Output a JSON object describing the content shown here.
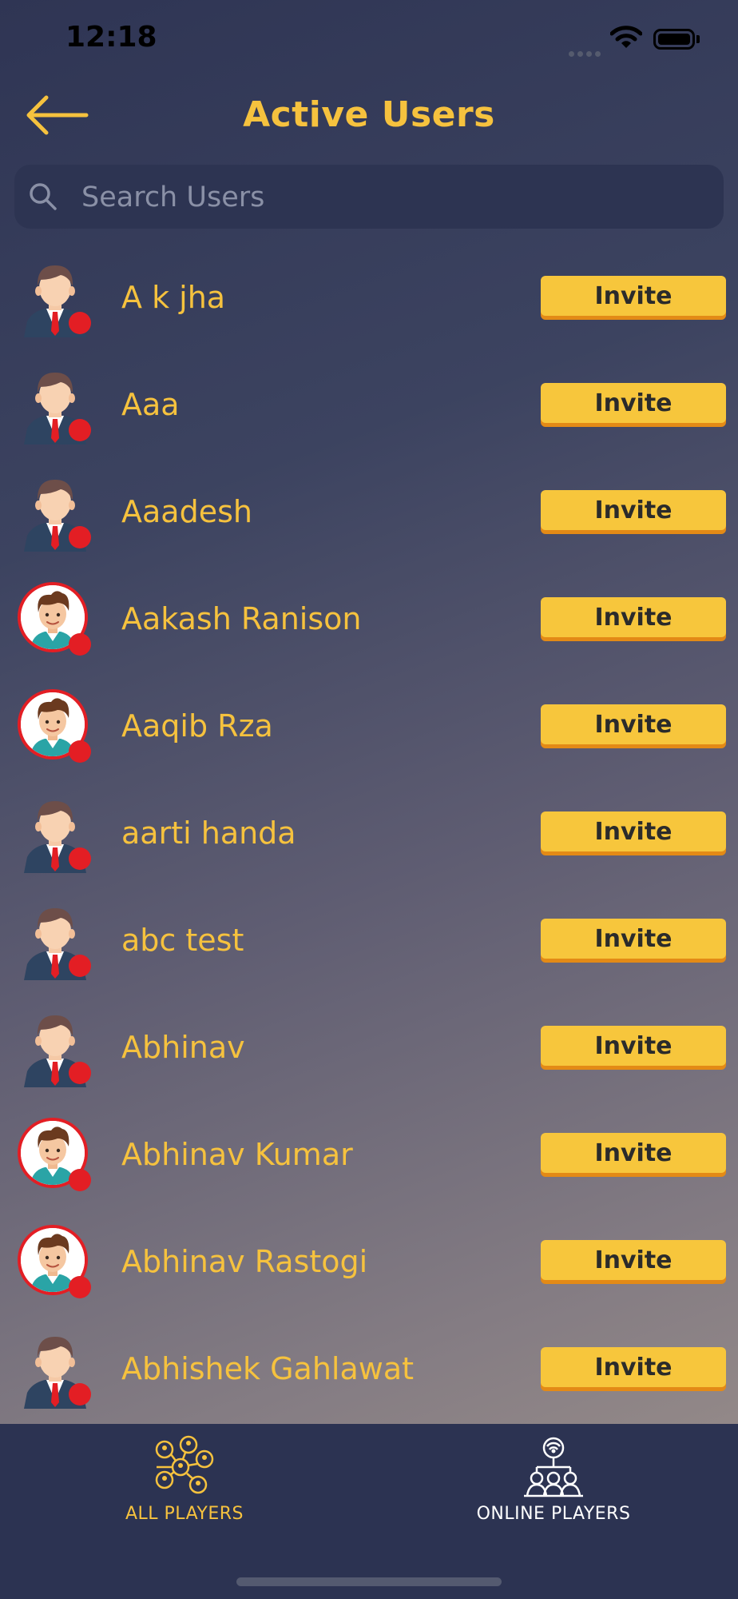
{
  "status_bar": {
    "time": "12:18"
  },
  "header": {
    "title": "Active Users"
  },
  "search": {
    "placeholder": "Search Users"
  },
  "users": [
    {
      "name": "A k jha",
      "avatar": "default-suit",
      "invite_label": "Invite"
    },
    {
      "name": "Aaa",
      "avatar": "default-suit",
      "invite_label": "Invite"
    },
    {
      "name": "Aaadesh",
      "avatar": "default-suit",
      "invite_label": "Invite"
    },
    {
      "name": "Aakash Ranison",
      "avatar": "cartoon-photo",
      "invite_label": "Invite"
    },
    {
      "name": "Aaqib Rza",
      "avatar": "cartoon-photo",
      "invite_label": "Invite"
    },
    {
      "name": "aarti handa",
      "avatar": "default-suit",
      "invite_label": "Invite"
    },
    {
      "name": "abc test",
      "avatar": "default-suit",
      "invite_label": "Invite"
    },
    {
      "name": "Abhinav",
      "avatar": "default-suit",
      "invite_label": "Invite"
    },
    {
      "name": "Abhinav Kumar",
      "avatar": "cartoon-photo",
      "invite_label": "Invite"
    },
    {
      "name": "Abhinav Rastogi",
      "avatar": "cartoon-photo",
      "invite_label": "Invite"
    },
    {
      "name": "Abhishek Gahlawat",
      "avatar": "default-suit",
      "invite_label": "Invite"
    }
  ],
  "tabs": [
    {
      "label": "ALL PLAYERS",
      "icon": "all-players-icon",
      "active": true
    },
    {
      "label": "ONLINE PLAYERS",
      "icon": "online-players-icon",
      "active": false
    }
  ],
  "colors": {
    "accent": "#f6c23e",
    "invite_button": "#f7c63c",
    "status_offline": "#e31e24",
    "tab_bar": "#2c3352"
  }
}
